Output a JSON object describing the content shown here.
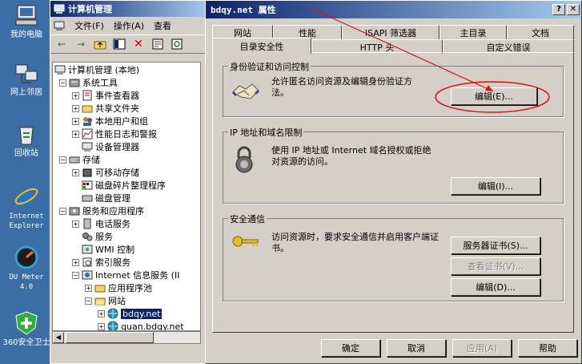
{
  "desktop": {
    "icons": [
      {
        "label": "我的电脑"
      },
      {
        "label": "网上邻居"
      },
      {
        "label": "回收站"
      },
      {
        "label": "Internet Explorer"
      },
      {
        "label": "DU Meter 4.0"
      },
      {
        "label": "360安全卫士"
      }
    ]
  },
  "mmc": {
    "title": "计算机管理",
    "menu": [
      "文件(F)",
      "操作(A)",
      "查看"
    ],
    "tree": [
      {
        "label": "计算机管理 (本地)"
      },
      {
        "label": "系统工具"
      },
      {
        "label": "事件查看器"
      },
      {
        "label": "共享文件夹"
      },
      {
        "label": "本地用户和组"
      },
      {
        "label": "性能日志和警报"
      },
      {
        "label": "设备管理器"
      },
      {
        "label": "存储"
      },
      {
        "label": "可移动存储"
      },
      {
        "label": "磁盘碎片整理程序"
      },
      {
        "label": "磁盘管理"
      },
      {
        "label": "服务和应用程序"
      },
      {
        "label": "电话服务"
      },
      {
        "label": "服务"
      },
      {
        "label": "WMI 控制"
      },
      {
        "label": "索引服务"
      },
      {
        "label": "Internet 信息服务 (II"
      },
      {
        "label": "应用程序池"
      },
      {
        "label": "网站"
      },
      {
        "label": "bdqy.net"
      },
      {
        "label": "quan.bdqy.net"
      }
    ]
  },
  "dialog": {
    "title": "bdqy.net 属性",
    "tabs_back": [
      "网站",
      "性能",
      "ISAPI 筛选器",
      "主目录",
      "文档"
    ],
    "tabs_front": [
      "目录安全性",
      "HTTP 头",
      "自定义错误"
    ],
    "auth": {
      "title": "身份验证和访问控制",
      "desc": "允许匿名访问资源及编辑身份验证方法。",
      "edit": "编辑(E)..."
    },
    "ip": {
      "title": "IP 地址和域名限制",
      "desc": "使用 IP 地址或 Internet 域名授权或拒绝对资源的访问。",
      "edit": "编辑(I)..."
    },
    "secure": {
      "title": "安全通信",
      "desc": "访问资源时，要求安全通信并启用客户端证书。",
      "server_cert": "服务器证书(S)...",
      "view_cert": "查看证书(V)...",
      "edit": "编辑(D)..."
    },
    "buttons": {
      "ok": "确定",
      "cancel": "取消",
      "apply": "应用(A)",
      "help": "帮助"
    }
  },
  "colors": {
    "desktop": "#3a6ea5",
    "titlebar": "#0a246a",
    "annotation": "#e01010"
  }
}
